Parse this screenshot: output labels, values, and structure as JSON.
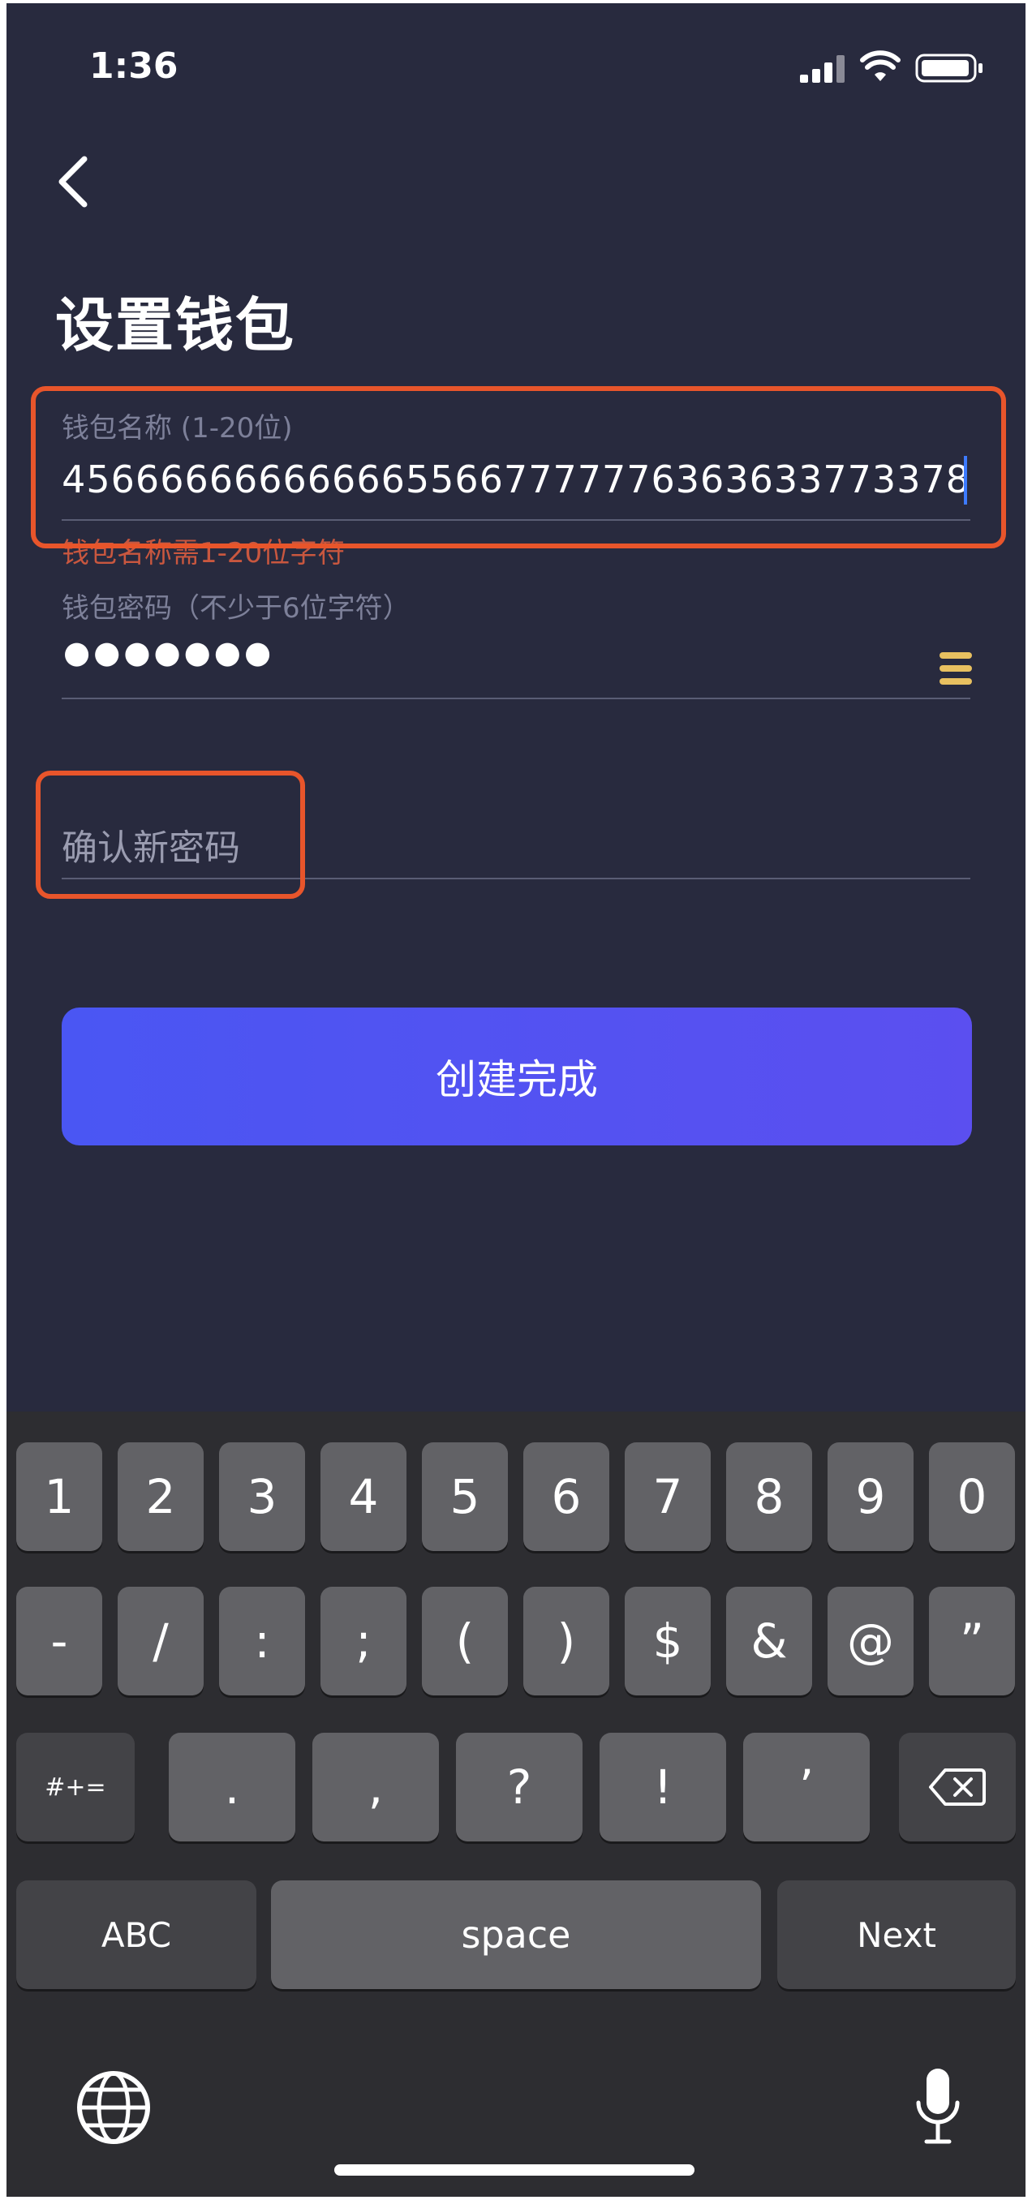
{
  "status_bar": {
    "time": "1:36"
  },
  "header": {
    "title": "设置钱包"
  },
  "form": {
    "name_label": "钱包名称 (1-20位)",
    "name_value": "444566666666666655667777776363633773378",
    "name_error": "钱包名称需1-20位字符",
    "password_label": "钱包密码（不少于6位字符）",
    "password_value": "●●●●●●●",
    "confirm_placeholder": "确认新密码"
  },
  "submit": {
    "label": "创建完成"
  },
  "keyboard": {
    "row1": [
      "1",
      "2",
      "3",
      "4",
      "5",
      "6",
      "7",
      "8",
      "9",
      "0"
    ],
    "row2": [
      "-",
      "/",
      ":",
      ";",
      "(",
      ")",
      "$",
      "&",
      "@",
      "”"
    ],
    "row3_left": "#+=",
    "row3": [
      ".",
      ",",
      "?",
      "!",
      "’"
    ],
    "abc": "ABC",
    "space": "space",
    "next": "Next"
  },
  "colors": {
    "background": "#282a3e",
    "accent": "#4a56f3",
    "error": "#c9573f",
    "highlight": "#e8552b"
  }
}
